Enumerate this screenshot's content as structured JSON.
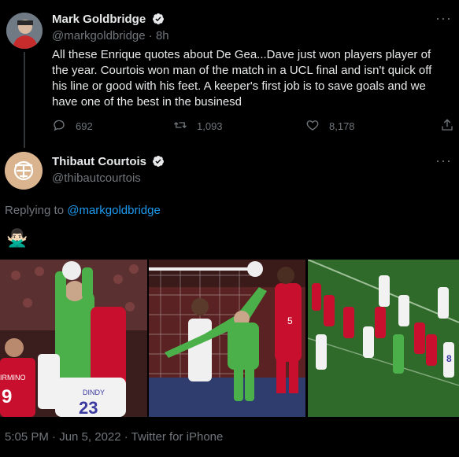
{
  "parent_tweet": {
    "author_name": "Mark Goldbridge",
    "author_handle": "@markgoldbridge",
    "time_sep": "·",
    "time": "8h",
    "text": "All these Enrique quotes about De Gea...Dave just won players player of the year. Courtois won man of the match in a UCL final and isn't quick off his line or good with his feet. A keeper's first job is to save goals and we have one of the best in the businesd",
    "actions": {
      "replies": "692",
      "retweets": "1,093",
      "likes": "8,178"
    }
  },
  "reply_tweet": {
    "author_name": "Thibaut Courtois",
    "author_handle": "@thibautcourtois",
    "replying_to_label": "Replying to",
    "replying_to_handle": "@markgoldbridge",
    "emoji": "🙅🏻‍♂️",
    "photos": [
      {
        "jersey_text": "IRMINO",
        "jersey_number": "9",
        "back_name": "DINDY",
        "back_number": "23"
      },
      {
        "keeper_number": "5"
      },
      {
        "jersey_number": "8"
      }
    ],
    "timestamp": "5:05 PM · Jun 5, 2022 · Twitter for iPhone"
  },
  "colors": {
    "background": "#000000",
    "text_primary": "#e7e9ea",
    "text_secondary": "#71767b",
    "link": "#1d9bf0",
    "verified": "#1d9bf0"
  },
  "icons": [
    "verified-badge-icon",
    "more-icon",
    "reply-icon",
    "retweet-icon",
    "like-icon",
    "share-icon"
  ]
}
